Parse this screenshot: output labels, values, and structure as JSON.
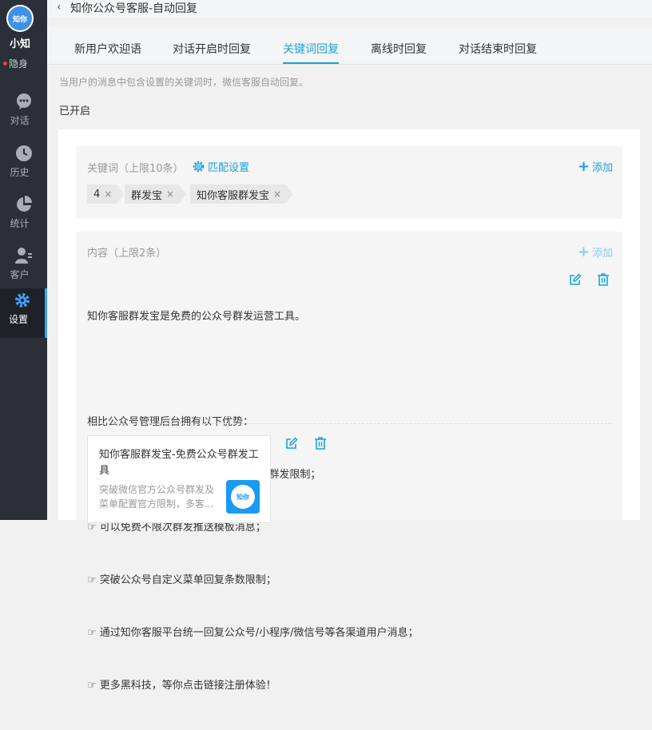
{
  "sidebar": {
    "user_name": "小知",
    "avatar_logo": "知你",
    "status": "隐身",
    "items": [
      {
        "label": "对话",
        "icon": "chat-icon"
      },
      {
        "label": "历史",
        "icon": "clock-icon"
      },
      {
        "label": "统计",
        "icon": "pie-chart-icon"
      },
      {
        "label": "客户",
        "icon": "user-list-icon"
      },
      {
        "label": "设置",
        "icon": "gear-icon",
        "active": true
      }
    ]
  },
  "header": {
    "back_icon": "‹",
    "title": "知你公众号客服-自动回复"
  },
  "tabs": [
    {
      "label": "新用户欢迎语"
    },
    {
      "label": "对话开启时回复"
    },
    {
      "label": "关键词回复",
      "active": true
    },
    {
      "label": "离线时回复"
    },
    {
      "label": "对话结束时回复"
    }
  ],
  "hint": "当用户的消息中包含设置的关键词时，微信客服自动回复。",
  "status_text": "已开启",
  "keywords": {
    "title": "关键词（上限10条）",
    "match_settings": "匹配设置",
    "add_label": "添加",
    "tags": [
      "4",
      "群发宝",
      "知你客服群发宝"
    ],
    "remove_symbol": "×"
  },
  "content": {
    "title": "内容（上限2条）",
    "add_label": "添加",
    "message_lines": [
      "知你客服群发宝是免费的公众号群发运营工具。",
      "",
      "相比公众号管理后台拥有以下优势：",
      "☞ 突破订阅号一天1次，服务号每月4次群发限制；",
      "☞ 可以免费不限次群发推送模板消息；",
      "☞ 突破公众号自定义菜单回复条数限制；",
      "☞ 通过知你客服平台统一回复公众号/小程序/微信号等各渠道用户消息；",
      "☞ 更多黑科技，等你点击链接注册体验！"
    ],
    "article": {
      "title": "知你客服群发宝-免费公众号群发工具",
      "description": "突破微信官方公众号群发及菜单配置官方限制，多客...",
      "thumb_logo": "知你"
    }
  },
  "colors": {
    "accent": "#1aa1de",
    "sidebar_bg": "#2b2f37",
    "status_dot": "#e0443e"
  }
}
